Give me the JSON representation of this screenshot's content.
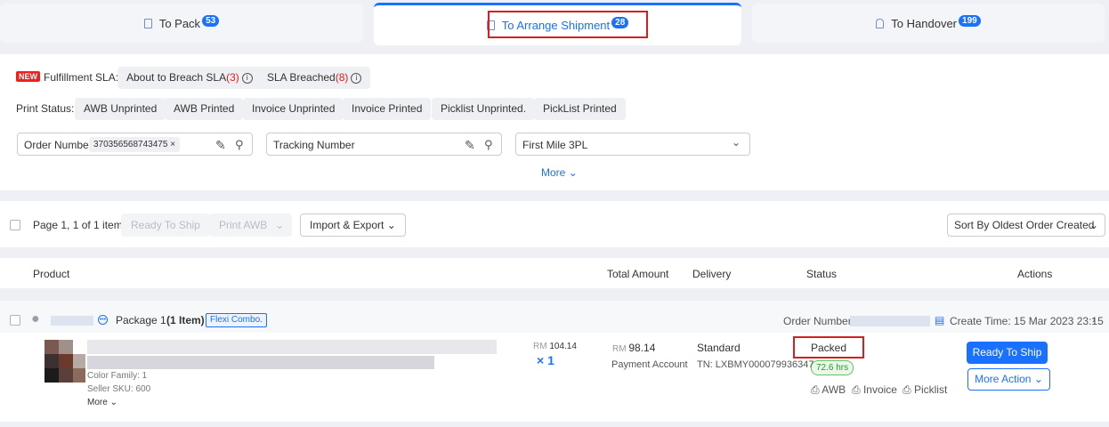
{
  "tabs": [
    {
      "label": "To Pack",
      "count": "53"
    },
    {
      "label": "To Arrange Shipment",
      "count": "28"
    },
    {
      "label": "To Handover",
      "count": "199"
    }
  ],
  "filters": {
    "new_tag": "NEW",
    "fulfillment_sla_label": "Fulfillment SLA:",
    "about_to_breach": "About to Breach SLA",
    "about_to_breach_count": "(3)",
    "sla_breached": "SLA Breached",
    "sla_breached_count": "(8)",
    "print_status_label": "Print Status:",
    "print_status_options": [
      "AWB Unprinted",
      "AWB Printed",
      "Invoice Unprinted",
      "Invoice Printed",
      "Picklist Unprinted.",
      "PickList Printed"
    ],
    "order_number_label": "Order Number",
    "order_number_value": "370356568743475",
    "tracking_number_placeholder": "Tracking Number",
    "first_mile_value": "First Mile 3PL",
    "more_label": "More"
  },
  "toolbar": {
    "page_info": "Page 1, 1 of 1 item",
    "ready_to_ship": "Ready To Ship",
    "print_awb": "Print AWB",
    "import_export": "Import & Export",
    "sort_by_label": "Sort By",
    "sort_by_value": "Oldest Order Created"
  },
  "table": {
    "headers": [
      "Product",
      "Total Amount",
      "Delivery",
      "Status",
      "Actions"
    ]
  },
  "order": {
    "package_label": "Package 1",
    "item_count": "(1 Item)",
    "flexi_tag": "Flexi Combo.",
    "order_number_label": "Order Number:",
    "create_time": "Create Time: 15 Mar 2023 23:15",
    "color_family": "Color Family: 1",
    "seller_sku": "Seller SKU: 600",
    "more": "More",
    "unit_price_currency": "RM",
    "unit_price": "104.14",
    "quantity": "× 1",
    "total_currency": "RM",
    "total_amount": "98.14",
    "payment_account": "Payment Account",
    "delivery_type": "Standard",
    "tracking_number": "TN: LXBMY000079936347",
    "status": "Packed",
    "hours": "72.6 hrs",
    "awb": "AWB",
    "invoice": "Invoice",
    "picklist": "Picklist",
    "ready_to_ship_button": "Ready To Ship",
    "more_action_button": "More Action"
  },
  "colors": {
    "accent": "#1a71ff",
    "highlight": "#d32020",
    "new_tag": "#f02020",
    "status_green": "#2a9a2a"
  }
}
